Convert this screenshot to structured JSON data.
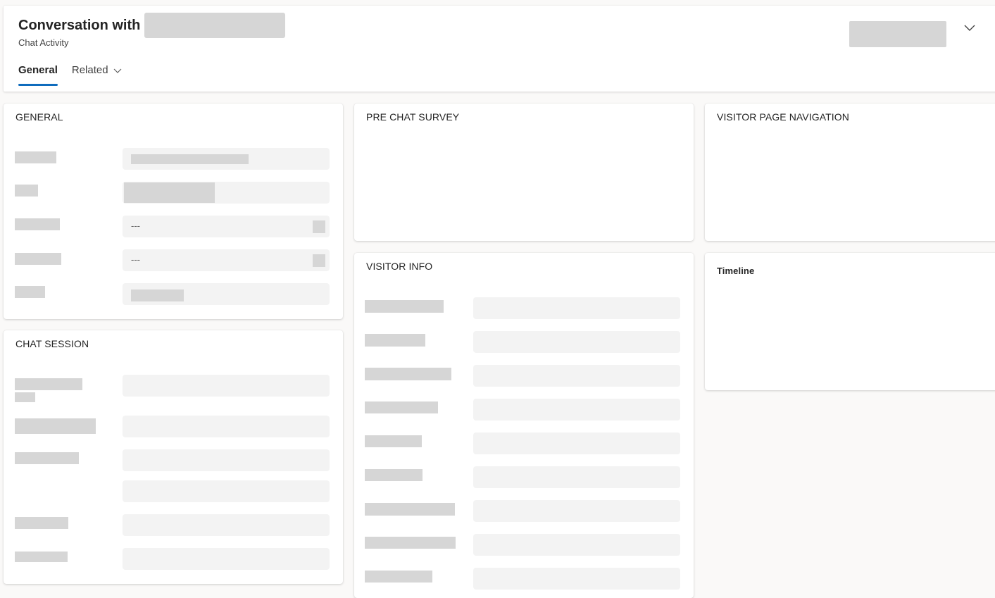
{
  "header": {
    "title": "Conversation with",
    "subtitle": "Chat Activity",
    "tabs": [
      {
        "label": "General",
        "active": true
      },
      {
        "label": "Related",
        "active": false
      }
    ]
  },
  "sections": {
    "general": {
      "title": "GENERAL",
      "empty_value": "---"
    },
    "chat_session": {
      "title": "CHAT SESSION"
    },
    "pre_chat_survey": {
      "title": "PRE CHAT SURVEY"
    },
    "visitor_info": {
      "title": "VISITOR INFO"
    },
    "visitor_page_navigation": {
      "title": "VISITOR PAGE NAVIGATION"
    },
    "timeline": {
      "title": "Timeline"
    }
  },
  "colors": {
    "accent": "#0f6cbd",
    "redaction": "#d6d6d6",
    "field_background": "#f3f3f3"
  },
  "icons": [
    "chevron-down-icon"
  ]
}
